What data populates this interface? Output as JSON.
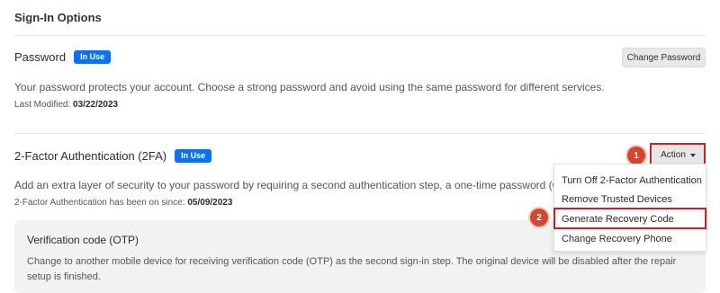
{
  "header": {
    "title": "Sign-In Options"
  },
  "password": {
    "title": "Password",
    "badge": "In Use",
    "button": "Change Password",
    "description": "Your password protects your account. Choose a strong password and avoid using the same password for different services.",
    "meta_label": "Last Modified:",
    "meta_value": "03/22/2023"
  },
  "twofa": {
    "title": "2-Factor Authentication (2FA)",
    "badge": "In Use",
    "action_button": "Action",
    "description": "Add an extra layer of security to your password by requiring a second authentication step, a one-time password (OTP).",
    "meta_label": "2-Factor Authentication has been on since:",
    "meta_value": "05/09/2023",
    "menu": [
      "Turn Off 2-Factor Authentication",
      "Remove Trusted Devices",
      "Generate Recovery Code",
      "Change Recovery Phone"
    ]
  },
  "annotations": {
    "step1": "1",
    "step2": "2"
  },
  "verification": {
    "title": "Verification code (OTP)",
    "description": "Change to another mobile device for receiving verification code (OTP) as the second sign-in step. The original device will be disabled after the repair setup is finished."
  },
  "colors": {
    "badge": "#0e71eb",
    "highlight": "#d11b26",
    "step_marker": "#d2472e"
  }
}
